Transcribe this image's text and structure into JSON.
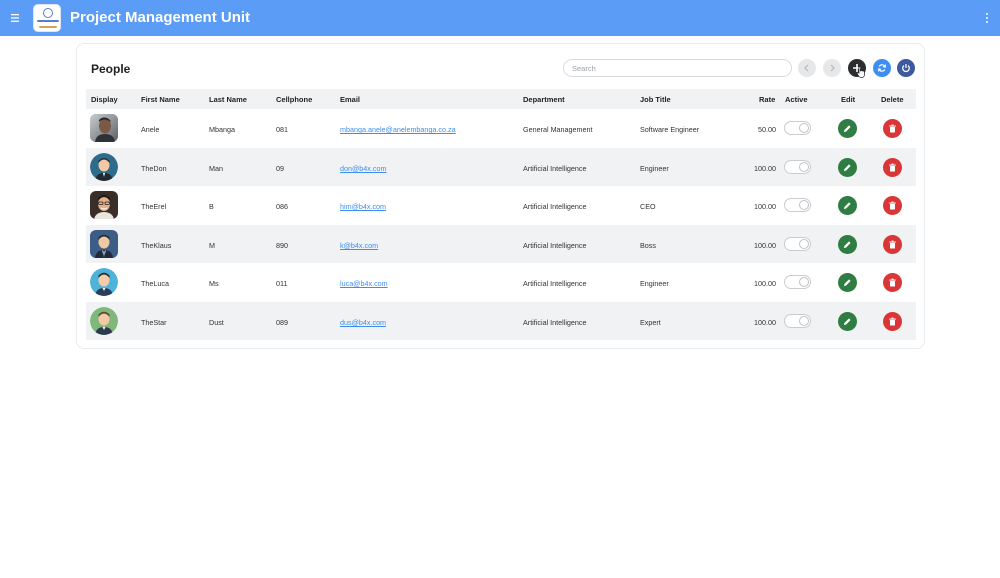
{
  "app": {
    "title": "Project Management Unit",
    "menu_icon": "hamburger-icon",
    "more_icon": "kebab-menu-icon",
    "accent_color": "#5b9cf6"
  },
  "card": {
    "title": "People",
    "search_placeholder": "Search",
    "toolbar_icons": [
      "chevron-left-icon",
      "chevron-right-icon",
      "plus-icon",
      "refresh-icon",
      "power-icon"
    ]
  },
  "table": {
    "columns": [
      "Display",
      "First Name",
      "Last Name",
      "Cellphone",
      "Email",
      "Department",
      "Job Title",
      "Rate",
      "Active",
      "Edit",
      "Delete"
    ],
    "rows": [
      {
        "first": "Anele",
        "last": "Mbanga",
        "cell": "081",
        "email": "mbanga.anele@anelembanga.co.za",
        "dept": "General Management",
        "job": "Software Engineer",
        "rate": "50.00"
      },
      {
        "first": "TheDon",
        "last": "Man",
        "cell": "09",
        "email": "don@b4x.com",
        "dept": "Artificial Intelligence",
        "job": "Engineer",
        "rate": "100.00"
      },
      {
        "first": "TheErel",
        "last": "B",
        "cell": "086",
        "email": "him@b4x.com",
        "dept": "Artificial Intelligence",
        "job": "CEO",
        "rate": "100.00"
      },
      {
        "first": "TheKlaus",
        "last": "M",
        "cell": "890",
        "email": "k@b4x.com",
        "dept": "Artificial Intelligence",
        "job": "Boss",
        "rate": "100.00"
      },
      {
        "first": "TheLuca",
        "last": "Ms",
        "cell": "011",
        "email": "luca@b4x.com",
        "dept": "Artificial Intelligence",
        "job": "Engineer",
        "rate": "100.00"
      },
      {
        "first": "TheStar",
        "last": "Dust",
        "cell": "089",
        "email": "dus@b4x.com",
        "dept": "Artificial Intelligence",
        "job": "Expert",
        "rate": "100.00"
      }
    ]
  }
}
